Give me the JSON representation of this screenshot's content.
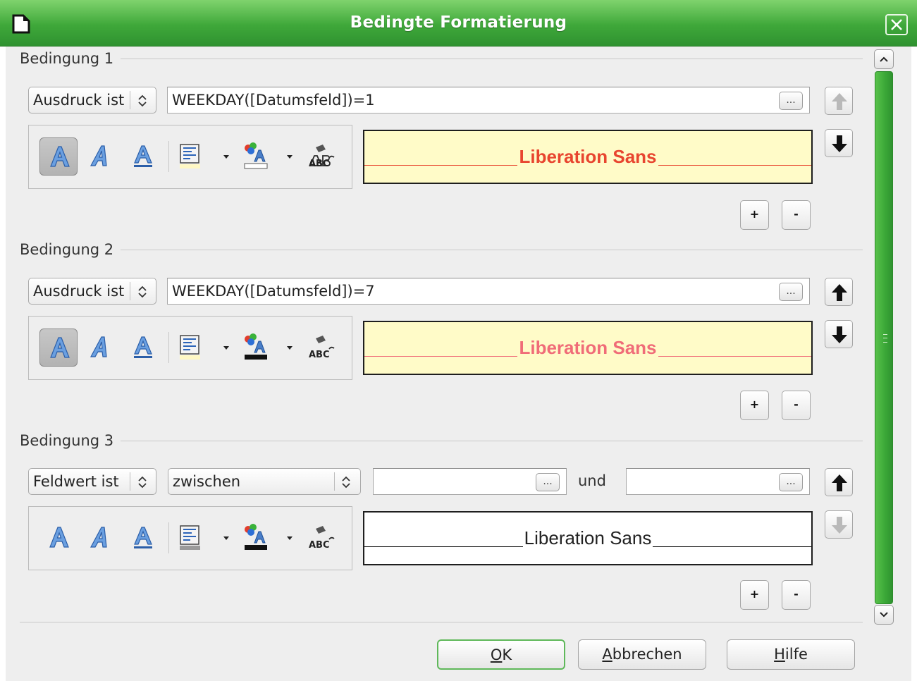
{
  "window": {
    "title": "Bedingte Formatierung",
    "title_bar_color": "#3fa83a"
  },
  "conditions": [
    {
      "label": "Bedingung 1",
      "type_select": "Ausdruck ist",
      "expression": "WEEKDAY([Datumsfeld])=1",
      "dots": "...",
      "up_enabled": false,
      "down_enabled": true,
      "bold_pressed": true,
      "preview_text": "Liberation Sans",
      "preview_bg": "#fffbc8",
      "preview_color": "#e8452f",
      "preview_line": "#e8452f"
    },
    {
      "label": "Bedingung 2",
      "type_select": "Ausdruck ist",
      "expression": "WEEKDAY([Datumsfeld])=7",
      "dots": "...",
      "up_enabled": true,
      "down_enabled": true,
      "bold_pressed": true,
      "preview_text": "Liberation Sans",
      "preview_bg": "#fffbc8",
      "preview_color": "#f06c78",
      "preview_line": "#f06c78"
    },
    {
      "label": "Bedingung 3",
      "type_select": "Feldwert ist",
      "operator_select": "zwischen",
      "value1": "",
      "value2": "",
      "and_label": "und",
      "dots": "...",
      "up_enabled": true,
      "down_enabled": false,
      "bold_pressed": false,
      "preview_text": "Liberation Sans",
      "preview_bg": "#ffffff",
      "preview_color": "#222222",
      "preview_line": "#111111"
    }
  ],
  "toolbar_icons": [
    "bold-icon",
    "italic-icon",
    "underline-icon",
    "background-color-icon",
    "font-color-icon",
    "clear-format-icon"
  ],
  "add_label": "+",
  "remove_label": "-",
  "buttons": {
    "ok_mnemonic": "O",
    "ok_rest": "K",
    "cancel_mnemonic": "A",
    "cancel_rest": "bbrechen",
    "help_mnemonic": "H",
    "help_rest": "ilfe"
  }
}
